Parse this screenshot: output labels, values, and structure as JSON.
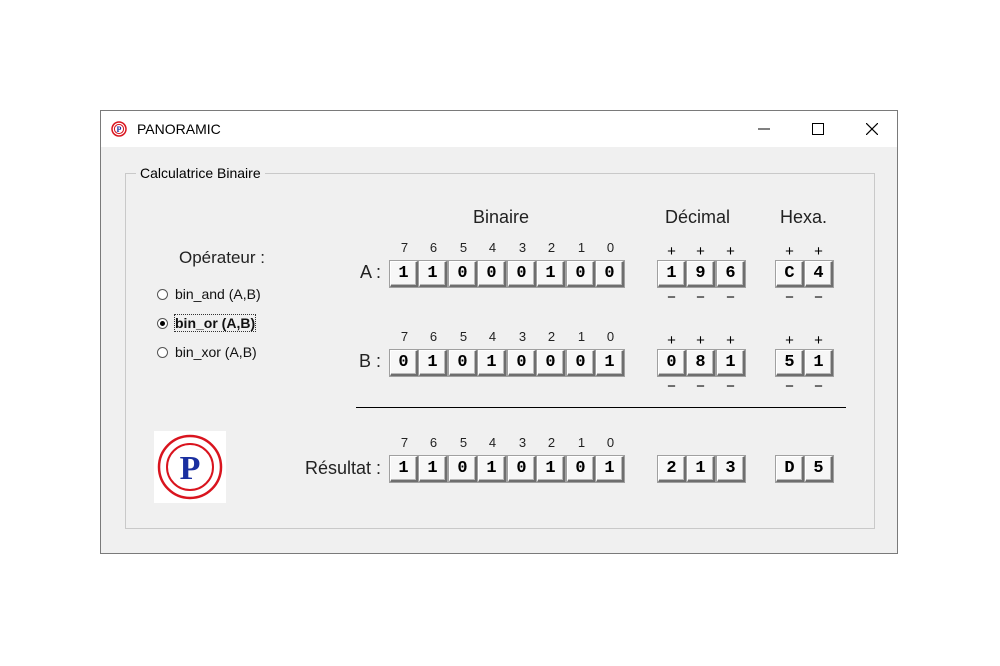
{
  "window": {
    "title": "PANORAMIC"
  },
  "icons": {
    "app": "panoramic-logo-icon",
    "minimize": "minimize-icon",
    "maximize": "maximize-icon",
    "close": "close-icon"
  },
  "group": {
    "title": "Calculatrice Binaire"
  },
  "headers": {
    "binary": "Binaire",
    "decimal": "Décimal",
    "hexa": "Hexa."
  },
  "operator": {
    "title": "Opérateur :",
    "options": [
      {
        "label": "bin_and (A,B)",
        "selected": false
      },
      {
        "label": "bin_or (A,B)",
        "selected": true
      },
      {
        "label": "bin_xor (A,B)",
        "selected": false
      }
    ]
  },
  "bit_numbers": [
    "7",
    "6",
    "5",
    "4",
    "3",
    "2",
    "1",
    "0"
  ],
  "plus": "+",
  "minus": "−",
  "rows": {
    "a": {
      "label": "A :",
      "binary": [
        "1",
        "1",
        "0",
        "0",
        "0",
        "1",
        "0",
        "0"
      ],
      "decimal": [
        "1",
        "9",
        "6"
      ],
      "hex": [
        "C",
        "4"
      ]
    },
    "b": {
      "label": "B :",
      "binary": [
        "0",
        "1",
        "0",
        "1",
        "0",
        "0",
        "0",
        "1"
      ],
      "decimal": [
        "0",
        "8",
        "1"
      ],
      "hex": [
        "5",
        "1"
      ]
    },
    "result": {
      "label": "Résultat :",
      "binary": [
        "1",
        "1",
        "0",
        "1",
        "0",
        "1",
        "0",
        "1"
      ],
      "decimal": [
        "2",
        "1",
        "3"
      ],
      "hex": [
        "D",
        "5"
      ]
    }
  },
  "colors": {
    "logo_red": "#d9141e",
    "logo_blue": "#1a2fa0"
  }
}
